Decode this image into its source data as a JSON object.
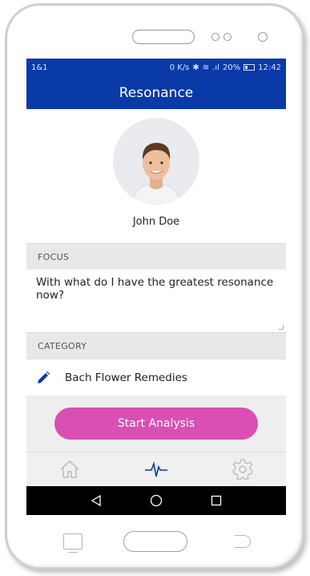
{
  "statusbar": {
    "carrier": "1&1",
    "net_speed": "0 K/s",
    "signal_text": ".ıl",
    "battery": "20%",
    "time": "12:42"
  },
  "appbar": {
    "title": "Resonance"
  },
  "profile": {
    "name": "John Doe"
  },
  "focus": {
    "header": "FOCUS",
    "text": "With what do I have the greatest resonance now?"
  },
  "category": {
    "header": "CATEGORY",
    "value": "Bach Flower Remedies"
  },
  "actions": {
    "start_label": "Start Analysis"
  },
  "bottom_nav": {
    "items": [
      {
        "icon": "home-icon",
        "active": false
      },
      {
        "icon": "pulse-icon",
        "active": true
      },
      {
        "icon": "gear-icon",
        "active": false
      }
    ]
  },
  "colors": {
    "primary": "#0a3aa8",
    "accent": "#d94fb5",
    "nav_inactive": "#b8b8b8"
  }
}
